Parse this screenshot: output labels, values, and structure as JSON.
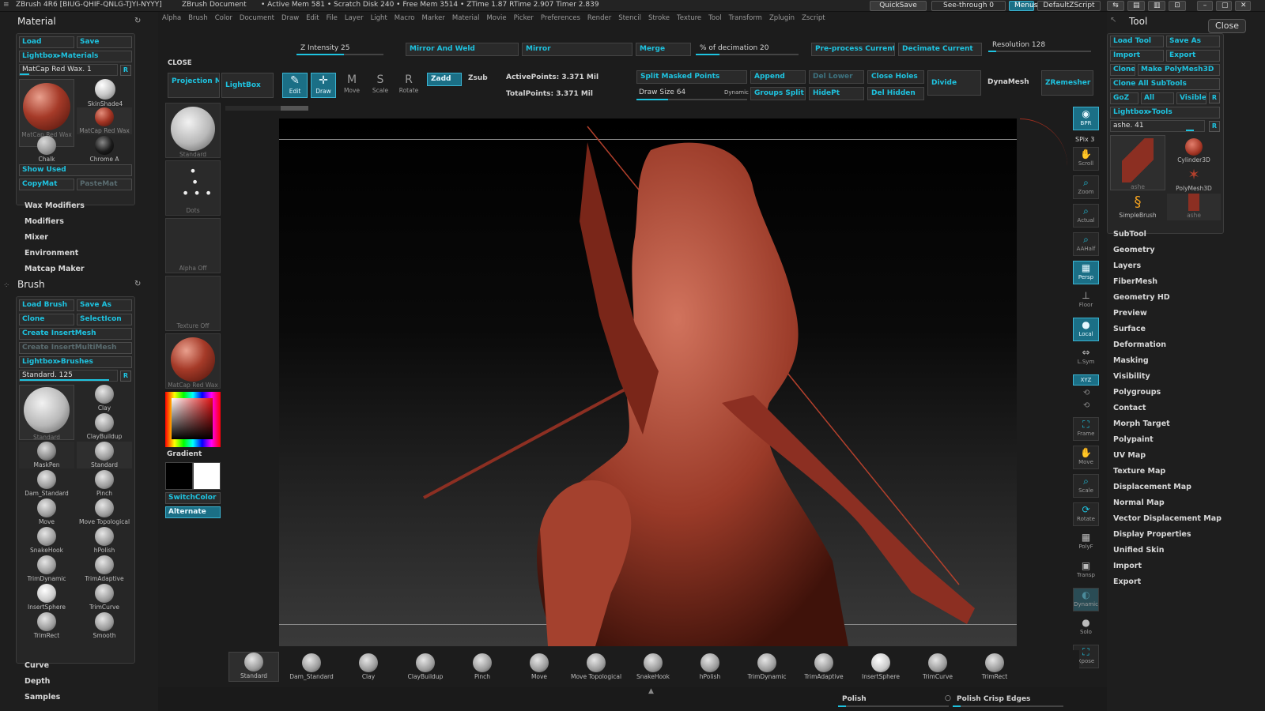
{
  "titlebar": {
    "app": "ZBrush 4R6 [BIUG-QHIF-QNLG-TJYI-NYYY]",
    "document": "ZBrush Document",
    "stats": "• Active Mem 581 • Scratch Disk 240 • Free Mem 3514 • ZTime 1.87 RTime 2.907 Timer 2.839",
    "quicksave": "QuickSave",
    "seethrough": "See-through 0",
    "menus": "Menus",
    "script": "DefaultZScript"
  },
  "menus": [
    "Alpha",
    "Brush",
    "Color",
    "Document",
    "Draw",
    "Edit",
    "File",
    "Layer",
    "Light",
    "Macro",
    "Marker",
    "Material",
    "Movie",
    "Picker",
    "Preferences",
    "Render",
    "Stencil",
    "Stroke",
    "Texture",
    "Tool",
    "Transform",
    "Zplugin",
    "Zscript"
  ],
  "close_label": "CLOSE",
  "material": {
    "title": "Material",
    "load": "Load",
    "save": "Save",
    "lightbox": "Lightbox▸Materials",
    "current": "MatCap Red Wax. 1",
    "r": "R",
    "thumbs": [
      "SkinShade4",
      "MatCap Red Wax",
      "Chalk",
      "Chrome A"
    ],
    "large_thumb": "MatCap Red Wax",
    "show_used": "Show Used",
    "copymat": "CopyMat",
    "pastemat": "PasteMat"
  },
  "material_subs": [
    "Wax Modifiers",
    "Modifiers",
    "Mixer",
    "Environment",
    "Matcap Maker"
  ],
  "brush": {
    "title": "Brush",
    "load": "Load Brush",
    "saveas": "Save As",
    "clone": "Clone",
    "selecticon": "SelectIcon",
    "create_insert": "Create InsertMesh",
    "create_multi": "Create InsertMultiMesh",
    "lightbox": "Lightbox▸Brushes",
    "current": "Standard. 125",
    "r": "R",
    "grid": [
      "Standard",
      "Clay",
      "ClayBuildup",
      "MaskPen",
      "Standard",
      "Dam_Standard",
      "Pinch",
      "Move",
      "Move Topological",
      "SnakeHook",
      "hPolish",
      "TrimDynamic",
      "TrimAdaptive",
      "InsertSphere",
      "TrimCurve",
      "TrimRect",
      "Smooth"
    ]
  },
  "brush_subs": [
    "Curve",
    "Depth",
    "Samples"
  ],
  "toolbar": {
    "projection_master": "Projection Master",
    "lightbox": "LightBox",
    "edit": "Edit",
    "draw": "Draw",
    "move": "Move",
    "scale": "Scale",
    "rotate": "Rotate",
    "zadd": "Zadd",
    "zsub": "Zsub",
    "z_intensity": "Z Intensity 25",
    "active_points": "ActivePoints: 3.371 Mil",
    "total_points": "TotalPoints: 3.371 Mil",
    "mirror_weld": "Mirror And Weld",
    "mirror": "Mirror",
    "merge": "Merge",
    "decimation": "% of decimation 20",
    "preprocess": "Pre-process Current",
    "decimate": "Decimate Current",
    "resolution": "Resolution 128",
    "split_masked": "Split Masked Points",
    "append": "Append",
    "del_lower": "Del Lower",
    "close_holes": "Close Holes",
    "divide": "Divide",
    "dynamesh": "DynaMesh",
    "zremesher": "ZRemesher",
    "draw_size": "Draw Size 64",
    "dynamic": "Dynamic",
    "groups_split": "Groups Split",
    "hidept": "HidePt",
    "del_hidden": "Del Hidden"
  },
  "left_strip": {
    "brush": "Standard",
    "stroke": "Dots",
    "alpha": "Alpha Off",
    "texture": "Texture Off",
    "material": "MatCap Red Wax",
    "gradient": "Gradient",
    "switchcolor": "SwitchColor",
    "alternate": "Alternate"
  },
  "right_strip": [
    "BPR",
    "SPix 3",
    "Scroll",
    "Zoom",
    "Actual",
    "AAHalf",
    "Persp",
    "Floor",
    "Local",
    "L.Sym",
    "XYZ",
    "Frame",
    "Move",
    "Scale",
    "Rotate",
    "PolyF",
    "Transp",
    "Dynamic",
    "Solo",
    "Xpose"
  ],
  "bottom_shelf": [
    "Standard",
    "Dam_Standard",
    "Clay",
    "ClayBuildup",
    "Pinch",
    "Move",
    "Move Topological",
    "SnakeHook",
    "hPolish",
    "TrimDynamic",
    "TrimAdaptive",
    "InsertSphere",
    "TrimCurve",
    "TrimRect"
  ],
  "bottom_bar": {
    "polish": "Polish",
    "polish_crisp": "Polish Crisp Edges"
  },
  "tool": {
    "title": "Tool",
    "close": "Close",
    "load": "Load Tool",
    "saveas": "Save As",
    "import": "Import",
    "export": "Export",
    "clone": "Clone",
    "make_polymesh": "Make PolyMesh3D",
    "clone_all": "Clone All SubTools",
    "goz": "GoZ",
    "all": "All",
    "visible": "Visible",
    "r": "R",
    "lightbox": "Lightbox▸Tools",
    "current": "ashe. 41",
    "thumbs": [
      "ashe",
      "Cylinder3D",
      "PolyMesh3D",
      "SimpleBrush",
      "ashe"
    ]
  },
  "tool_subs": [
    "SubTool",
    "Geometry",
    "Layers",
    "FiberMesh",
    "Geometry HD",
    "Preview",
    "Surface",
    "Deformation",
    "Masking",
    "Visibility",
    "Polygroups",
    "Contact",
    "Morph Target",
    "Polypaint",
    "UV Map",
    "Texture Map",
    "Displacement Map",
    "Normal Map",
    "Vector Displacement Map",
    "Display Properties",
    "Unified Skin",
    "Import",
    "Export"
  ],
  "colors": {
    "accent": "#1ec3e0",
    "model": "#8c2f22",
    "bg": "#1c1c1c"
  }
}
